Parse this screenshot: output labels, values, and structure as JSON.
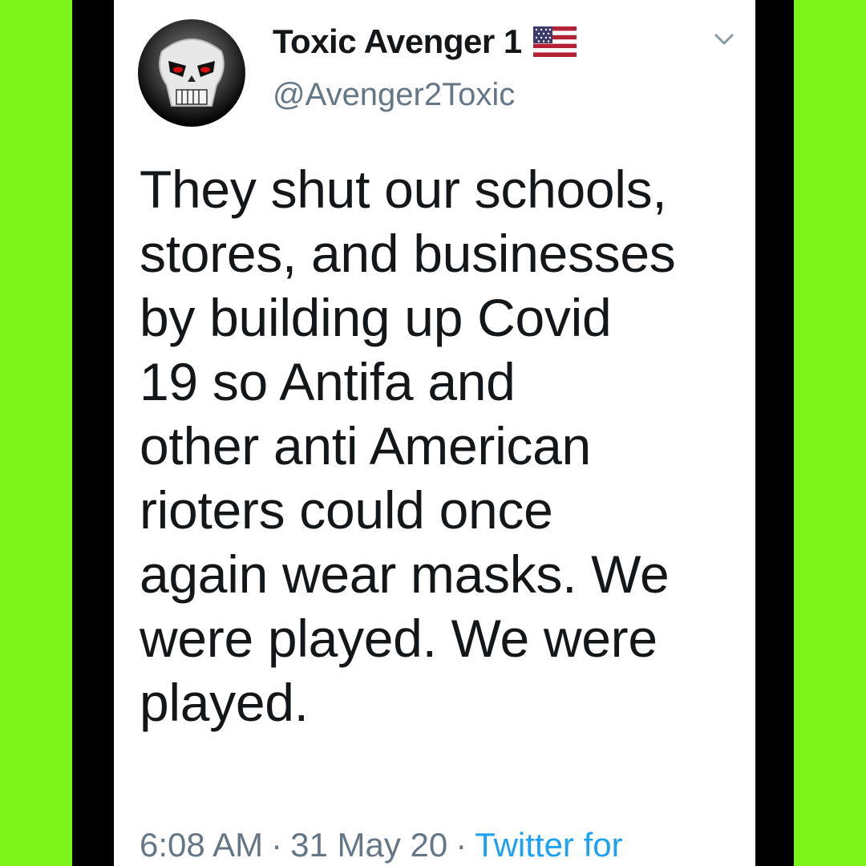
{
  "tweet": {
    "display_name": "Toxic Avenger 1",
    "handle": "@Avenger2Toxic",
    "flag_icon": "us-flag-icon",
    "menu_icon": "chevron-down-icon",
    "text": "They shut our schools,\nstores, and businesses\nby building up Covid\n19 so Antifa and\nother anti American\nrioters could once\nagain wear masks. We\nwere played. We were\nplayed.",
    "time": "6:08 AM",
    "date": "31 May 20",
    "source": "Twitter for",
    "separator": "·"
  },
  "colors": {
    "background": "#7ef51a",
    "frame": "#000000",
    "card": "#ffffff",
    "text": "#14171a",
    "secondary": "#657786",
    "link": "#1da1f2"
  }
}
